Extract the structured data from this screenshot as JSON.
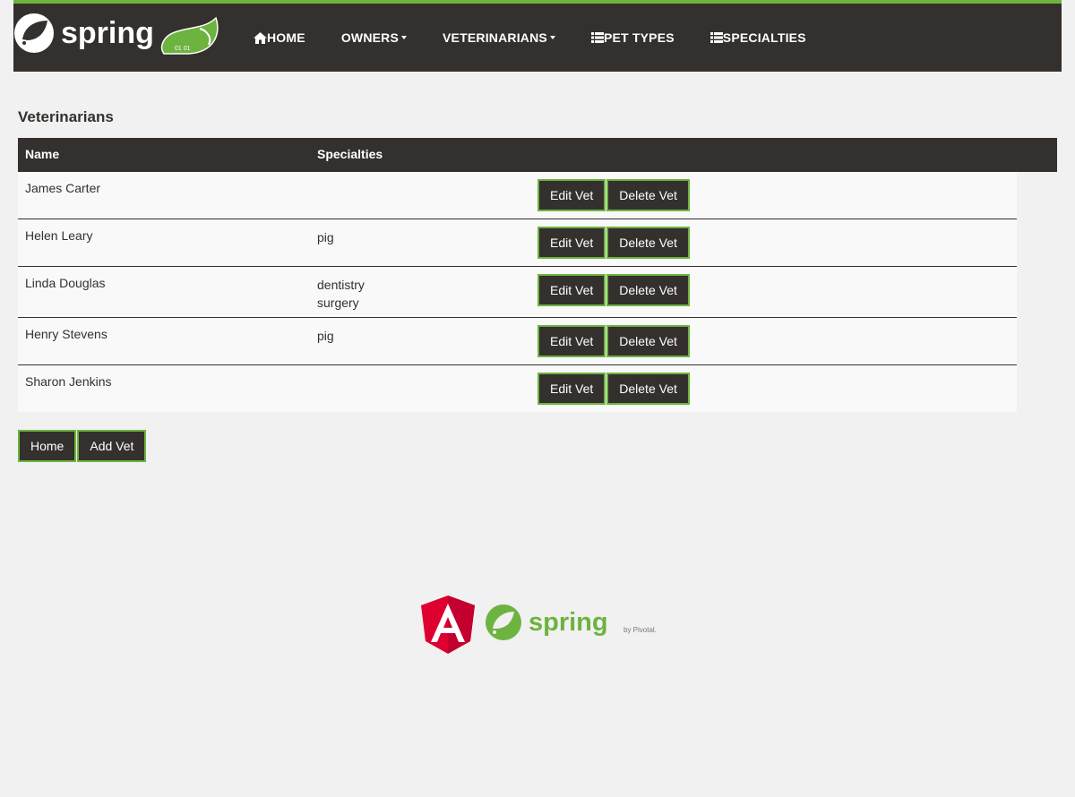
{
  "colors": {
    "brand_green": "#6db33f",
    "dark": "#34302d",
    "background": "#f1f1f1",
    "angular_red": "#dd0031"
  },
  "navbar": {
    "logo_text": "spring",
    "items": [
      {
        "label": "HOME",
        "icon": "home-icon",
        "dropdown": false
      },
      {
        "label": "OWNERS",
        "icon": null,
        "dropdown": true
      },
      {
        "label": "VETERINARIANS",
        "icon": null,
        "dropdown": true
      },
      {
        "label": "PET TYPES",
        "icon": "list-icon",
        "dropdown": false
      },
      {
        "label": "SPECIALTIES",
        "icon": "list-icon",
        "dropdown": false
      }
    ]
  },
  "page": {
    "title": "Veterinarians"
  },
  "table": {
    "headers": {
      "name": "Name",
      "specialties": "Specialties"
    },
    "rows": [
      {
        "name": "James Carter",
        "specialties": []
      },
      {
        "name": "Helen Leary",
        "specialties": [
          "pig"
        ]
      },
      {
        "name": "Linda Douglas",
        "specialties": [
          "dentistry",
          "surgery"
        ]
      },
      {
        "name": "Henry Stevens",
        "specialties": [
          "pig"
        ]
      },
      {
        "name": "Sharon Jenkins",
        "specialties": []
      }
    ],
    "row_actions": {
      "edit_label": "Edit Vet",
      "delete_label": "Delete Vet"
    }
  },
  "actions": {
    "home_label": "Home",
    "add_label": "Add Vet"
  },
  "footer": {
    "spring_text": "spring",
    "pivotal_text": "by Pivotal."
  }
}
